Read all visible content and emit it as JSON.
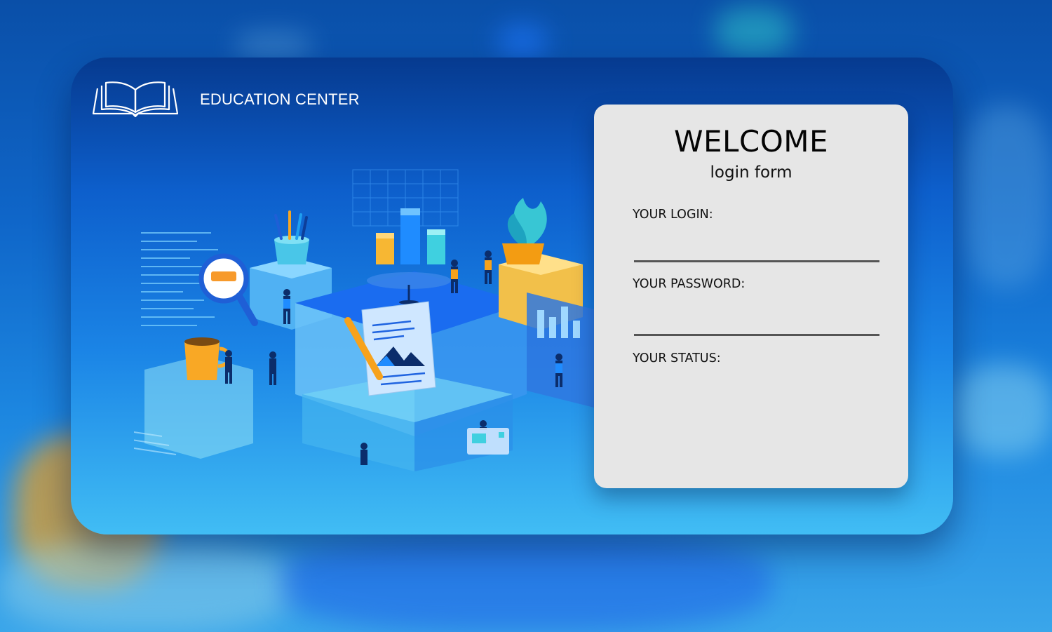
{
  "header": {
    "brand_name": "EDUCATION CENTER",
    "logo_icon": "open-book-icon"
  },
  "login_form": {
    "title": "WELCOME",
    "subtitle": "login form",
    "login_label": "YOUR LOGIN:",
    "login_value": "",
    "password_label": "YOUR PASSWORD:",
    "password_value": "",
    "status_label": "YOUR STATUS:"
  },
  "colors": {
    "card_top": "#063a8f",
    "card_bottom": "#41bdf4",
    "panel_bg": "#e6e6e6",
    "input_underline": "#555555"
  }
}
